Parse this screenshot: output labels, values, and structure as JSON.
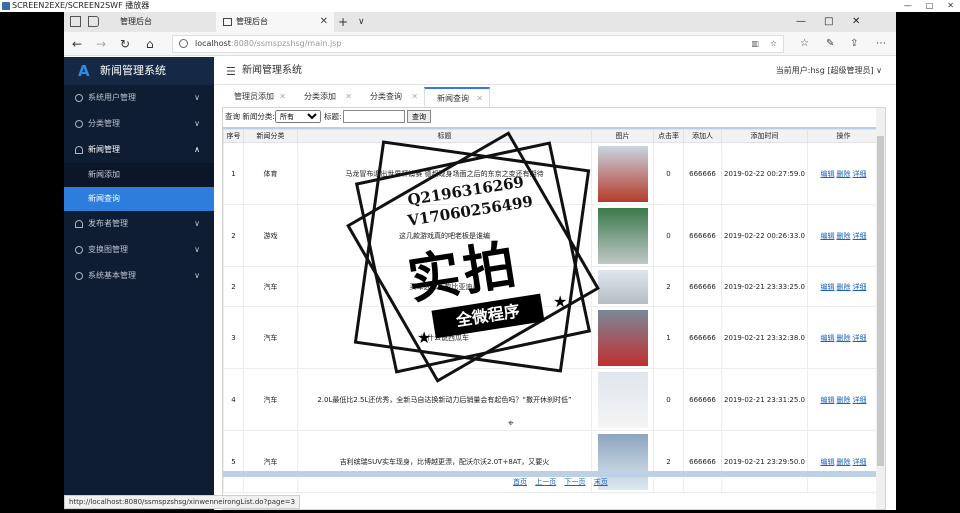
{
  "player": {
    "title": "SCREEN2EXE/SCREEN2SWF 播放器",
    "controls": [
      "—",
      "□",
      "✕"
    ]
  },
  "browser": {
    "tabs": [
      {
        "label": "管理后台",
        "active": false
      },
      {
        "label": "管理后台",
        "active": true
      }
    ],
    "url_host": "localhost",
    "url_path": ":8080/ssmspzshsg/main.jsp",
    "status_url": "http://localhost:8080/ssmspzshsg/xinwenneirongList.do?page=3"
  },
  "sidebar": {
    "logo": "A",
    "title": "新闻管理系统",
    "items": [
      {
        "label": "系统用户管理",
        "icon": "gear-icon",
        "open": false
      },
      {
        "label": "分类管理",
        "icon": "gear-icon",
        "open": false
      },
      {
        "label": "新闻管理",
        "icon": "user-icon",
        "open": true
      },
      {
        "label": "发布者管理",
        "icon": "user-icon",
        "open": false
      },
      {
        "label": "变换图管理",
        "icon": "gear-icon",
        "open": false
      },
      {
        "label": "系统基本管理",
        "icon": "gear-icon",
        "open": false
      }
    ],
    "sub_items": [
      {
        "label": "新闻添加",
        "active": false
      },
      {
        "label": "新闻查询",
        "active": true
      }
    ]
  },
  "header": {
    "title": "新闻管理系统",
    "current_user": "当前用户:hsg [超级管理员]"
  },
  "page_tabs": [
    {
      "label": "管理员添加"
    },
    {
      "label": "分类添加"
    },
    {
      "label": "分类查询"
    },
    {
      "label": "新闻查询",
      "active": true
    }
  ],
  "search": {
    "label_category": "查询 新闻分类:",
    "category_value": "所有",
    "label_title": "标题:",
    "title_value": "",
    "button": "查询"
  },
  "table": {
    "columns": [
      "序号",
      "新闻分类",
      "标题",
      "图片",
      "点击率",
      "添加人",
      "添加时间",
      "操作"
    ],
    "ops": [
      "编辑",
      "删除",
      "详细"
    ],
    "rows": [
      {
        "no": "1",
        "cat": "体育",
        "title": "马龙冒布退出世界杯澳赛 德叔现身场面之后的东京之变还有期待",
        "clicks": "0",
        "user": "666666",
        "time": "2019-02-22 00:27:59.0"
      },
      {
        "no": "2",
        "cat": "游戏",
        "title": "这几款游戏真的吧老板是谁编",
        "clicks": "0",
        "user": "666666",
        "time": "2019-02-22 00:26:33.0"
      },
      {
        "no": "2",
        "cat": "汽车",
        "title": "买车选择新款比亚迪秦",
        "clicks": "2",
        "user": "666666",
        "time": "2019-02-21 23:33:25.0"
      },
      {
        "no": "3",
        "cat": "汽车",
        "title": "为什么说西瓜车",
        "clicks": "1",
        "user": "666666",
        "time": "2019-02-21 23:32:38.0"
      },
      {
        "no": "4",
        "cat": "汽车",
        "title": "2.0L最低比2.5L还优秀，全新马自达换新动力后销量会有起色吗？“撒开休刹时低”",
        "clicks": "0",
        "user": "666666",
        "time": "2019-02-21 23:31:25.0"
      },
      {
        "no": "5",
        "cat": "汽车",
        "title": "吉利缤瑞SUV实车现身，比博越更漂，配沃尔沃2.0T+8AT，又要火",
        "clicks": "2",
        "user": "666666",
        "time": "2019-02-21 23:29:50.0"
      }
    ]
  },
  "pager": [
    "首页",
    "上一页",
    "下一页",
    "末页"
  ],
  "watermark": {
    "qq": "Q2196316269",
    "vx": "V17060256499",
    "big": "实拍",
    "band": "全微程序"
  },
  "colors": {
    "sidebar_bg": "#0f1d33",
    "accent": "#2d7ddc",
    "link": "#1c63c7"
  }
}
